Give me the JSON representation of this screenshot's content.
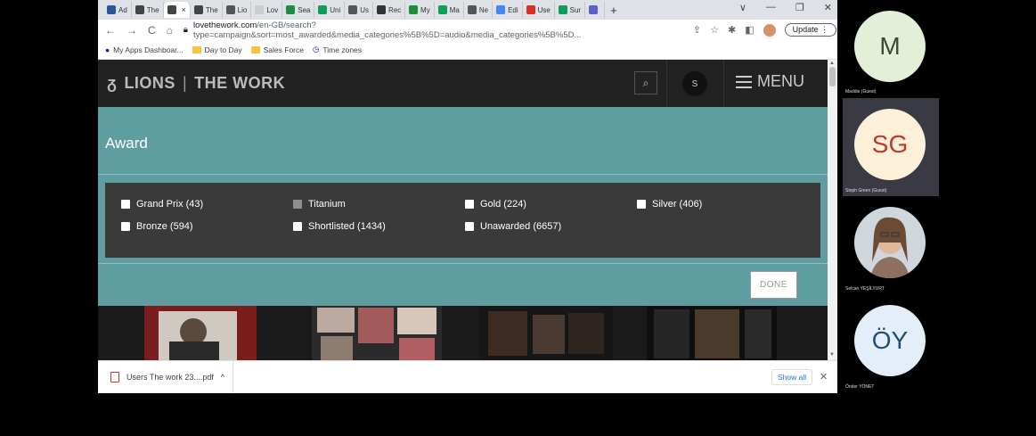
{
  "browser": {
    "tabs": [
      {
        "label": "Ad",
        "icon": "word-icon",
        "color": "#2b579a"
      },
      {
        "label": "The",
        "icon": "lions-icon",
        "color": "#444"
      },
      {
        "label": "",
        "icon": "lions-icon",
        "color": "#444",
        "active": true
      },
      {
        "label": "The",
        "icon": "lions-icon",
        "color": "#444"
      },
      {
        "label": "Lio",
        "icon": "globe-icon",
        "color": "#555"
      },
      {
        "label": "Lov",
        "icon": "blank-icon",
        "color": "#ccc"
      },
      {
        "label": "Sea",
        "icon": "drive-icon",
        "color": "#1e8e3e"
      },
      {
        "label": "Uni",
        "icon": "sheets-icon",
        "color": "#0f9d58"
      },
      {
        "label": "Us",
        "icon": "globe-icon",
        "color": "#555"
      },
      {
        "label": "Rec",
        "icon": "github-icon",
        "color": "#333"
      },
      {
        "label": "My",
        "icon": "drive-icon",
        "color": "#1e8e3e"
      },
      {
        "label": "Ma",
        "icon": "sheets-icon",
        "color": "#0f9d58"
      },
      {
        "label": "Ne",
        "icon": "globe-icon",
        "color": "#555"
      },
      {
        "label": "Edi",
        "icon": "edit-icon",
        "color": "#4285f4"
      },
      {
        "label": "Use",
        "icon": "pdf-icon",
        "color": "#d93025"
      },
      {
        "label": "Sur",
        "icon": "sheets-icon",
        "color": "#0f9d58"
      },
      {
        "label": "",
        "icon": "teams-icon",
        "color": "#5b5fc7"
      }
    ],
    "new_tab": "+",
    "window_controls": [
      "∨",
      "—",
      "❐",
      "✕"
    ],
    "url_host": "lovethework.com",
    "url_path": "/en-GB/search?type=campaign&sort=most_awarded&media_categories%5B%5D=audio&media_categories%5B%5D...",
    "update_label": "Update",
    "bookmarks": [
      {
        "label": "My Apps Dashboar...",
        "icon": "apps-icon"
      },
      {
        "label": "Day to Day",
        "icon": "folder-icon"
      },
      {
        "label": "Sales Force",
        "icon": "folder-icon"
      },
      {
        "label": "Time zones",
        "icon": "clock-icon"
      }
    ]
  },
  "site": {
    "logo_text": "LIONS",
    "logo_divider": "|",
    "logo_sub": "THE WORK",
    "user_initial": "S",
    "menu_label": "MENU"
  },
  "award_filter": {
    "title": "Award",
    "options": [
      {
        "label": "Grand Prix (43)",
        "disabled": false
      },
      {
        "label": "Titanium",
        "disabled": true
      },
      {
        "label": "Gold (224)",
        "disabled": false
      },
      {
        "label": "Silver (406)",
        "disabled": false
      },
      {
        "label": "Bronze (594)",
        "disabled": false
      },
      {
        "label": "Shortlisted (1434)",
        "disabled": false
      },
      {
        "label": "Unawarded (6657)",
        "disabled": false
      }
    ],
    "done_label": "DONE"
  },
  "downloads": {
    "file_name": "Users The work 23....pdf",
    "show_all_label": "Show all",
    "close": "✕"
  },
  "participants": [
    {
      "initials": "M",
      "name": "Maddie (Guest)",
      "color": "#e3efd6",
      "highlight": false
    },
    {
      "initials": "SG",
      "name": "Steph Green (Guest)",
      "color": "#fdf0d8",
      "highlight": true
    },
    {
      "initials": "",
      "name": "Selcan YEŞİLYURT",
      "color": "#6f5a4a",
      "highlight": false
    },
    {
      "initials": "ÖY",
      "name": "Önder YÖNET",
      "color": "#e4eef8",
      "highlight": false
    }
  ]
}
